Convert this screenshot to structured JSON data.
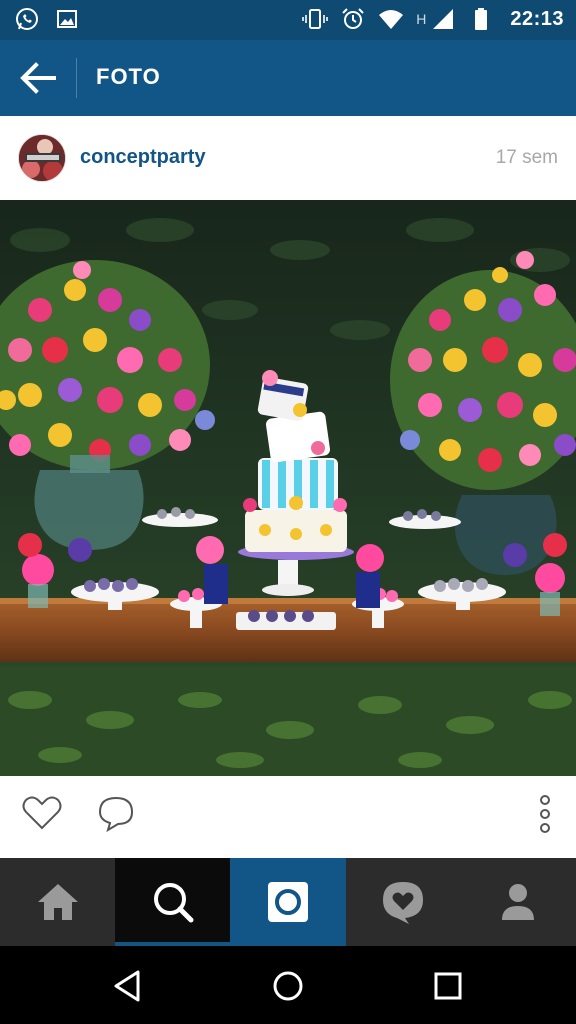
{
  "status_bar": {
    "time": "22:13",
    "network_type": "H",
    "icons": [
      "whatsapp-icon",
      "gallery-icon",
      "vibrate-icon",
      "alarm-icon",
      "wifi-icon",
      "signal-icon",
      "battery-icon"
    ]
  },
  "app_bar": {
    "title": "FOTO",
    "back_icon": "arrow-left-icon"
  },
  "post": {
    "username": "conceptparty",
    "timestamp": "17 sem",
    "photo_subject": "party dessert table with tiered cake and flower arrangements"
  },
  "actions": {
    "icons": [
      "heart-icon",
      "comment-icon",
      "more-vertical-icon"
    ]
  },
  "bottom_nav": {
    "items": [
      {
        "name": "home",
        "icon": "home-icon",
        "active": false
      },
      {
        "name": "search",
        "icon": "search-icon",
        "active": true
      },
      {
        "name": "camera",
        "icon": "camera-icon",
        "active": false
      },
      {
        "name": "activity",
        "icon": "heart-bubble-icon",
        "active": false
      },
      {
        "name": "profile",
        "icon": "person-icon",
        "active": false
      }
    ]
  },
  "system_nav": {
    "icons": [
      "back-triangle-icon",
      "home-circle-icon",
      "recents-square-icon"
    ]
  },
  "colors": {
    "status_bar": "#0e4a72",
    "app_bar": "#125688",
    "username": "#125688",
    "timestamp": "#a8a8a8",
    "nav_bg": "#2c2c2c",
    "nav_active": "#0b0b0b",
    "nav_camera": "#125688"
  }
}
